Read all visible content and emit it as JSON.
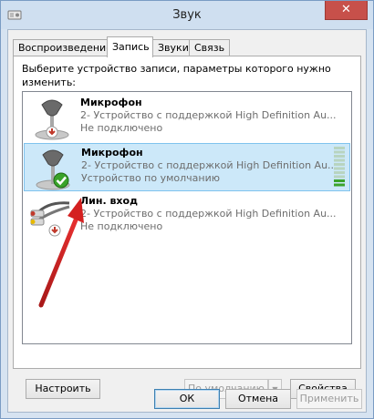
{
  "window": {
    "title": "Звук",
    "close_label": "✕"
  },
  "tabs": [
    {
      "label": "Воспроизведение",
      "active": false
    },
    {
      "label": "Запись",
      "active": true
    },
    {
      "label": "Звуки",
      "active": false
    },
    {
      "label": "Связь",
      "active": false
    }
  ],
  "panel": {
    "instruction": "Выберите устройство записи, параметры которого нужно изменить:"
  },
  "devices": [
    {
      "name": "Микрофон",
      "description": "2- Устройство с поддержкой High Definition Au...",
      "status": "Не подключено",
      "icon": "microphone-icon",
      "badge": "disconnected-badge-icon",
      "selected": false
    },
    {
      "name": "Микрофон",
      "description": "2- Устройство с поддержкой High Definition Au...",
      "status": "Устройство по умолчанию",
      "icon": "microphone-icon",
      "badge": "default-check-icon",
      "selected": true,
      "level": 0.2
    },
    {
      "name": "Лин. вход",
      "description": "2- Устройство с поддержкой High Definition Au...",
      "status": "Не подключено",
      "icon": "line-in-cable-icon",
      "badge": "disconnected-badge-icon",
      "selected": false
    }
  ],
  "buttons": {
    "configure": "Настроить",
    "set_default": "По умолчанию",
    "properties": "Свойства",
    "ok": "ОК",
    "cancel": "Отмена",
    "apply": "Применить"
  },
  "colors": {
    "selection": "#cce8f9",
    "close_red": "#c7504a",
    "check_green": "#3aa32a",
    "annotation_arrow": "#d42020"
  }
}
